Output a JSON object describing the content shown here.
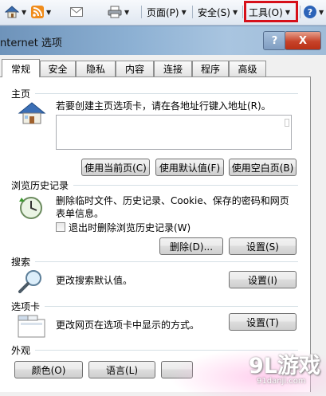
{
  "cmdbar": {
    "page_label": "页面(P)",
    "safety_label": "安全(S)",
    "tools_label": "工具(O)",
    "help_glyph": "?"
  },
  "dialog": {
    "title": "nternet 选项",
    "help_glyph": "?",
    "close_glyph": "X"
  },
  "tabs": [
    "常规",
    "安全",
    "隐私",
    "内容",
    "连接",
    "程序",
    "高级"
  ],
  "active_tab": "常规",
  "home": {
    "heading": "主页",
    "instruction": "若要创建主页选项卡，请在各地址行键入地址(R)。",
    "url_value": "",
    "btn_current": "使用当前页(C)",
    "btn_default": "使用默认值(F)",
    "btn_blank": "使用空白页(B)"
  },
  "history": {
    "heading": "浏览历史记录",
    "desc_line1": "删除临时文件、历史记录、Cookie、保存的密码和网页",
    "desc_line2": "表单信息。",
    "checkbox_label": "退出时删除浏览历史记录(W)",
    "checkbox_checked": false,
    "btn_delete": "删除(D)...",
    "btn_settings": "设置(S)"
  },
  "search": {
    "heading": "搜索",
    "desc": "更改搜索默认值。",
    "btn_settings": "设置(I)"
  },
  "tabs_section": {
    "heading": "选项卡",
    "desc": "更改网页在选项卡中显示的方式。",
    "btn_settings": "设置(T)"
  },
  "appearance": {
    "heading": "外观",
    "btn_colors": "颜色(O)",
    "btn_languages": "语言(L)"
  },
  "watermark": {
    "main": "9L游戏",
    "sub": "91danji.com"
  },
  "colors": {
    "highlight": "#d6101a",
    "title_bar": "#8cb0d3",
    "close_button": "#c7432a"
  }
}
